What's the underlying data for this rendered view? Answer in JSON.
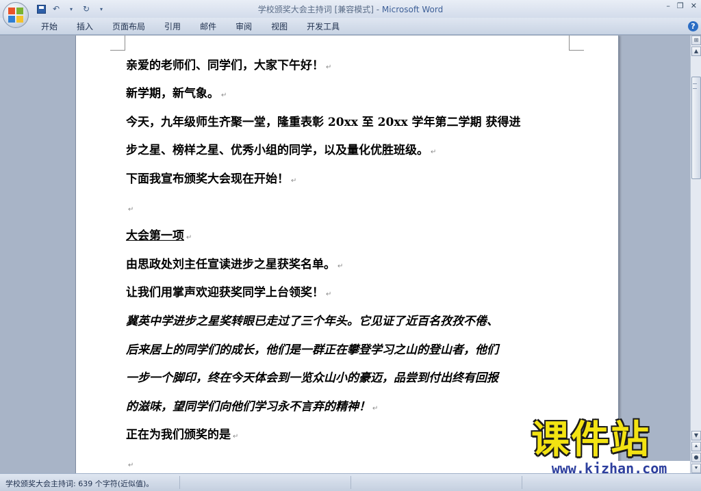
{
  "window": {
    "doc_title": "学校颁奖大会主持词 [兼容模式] - ",
    "app_name": "Microsoft Word"
  },
  "ribbon": {
    "tabs": [
      "开始",
      "插入",
      "页面布局",
      "引用",
      "邮件",
      "审阅",
      "视图",
      "开发工具"
    ],
    "help": "?"
  },
  "document": {
    "paragraphs": [
      {
        "text": "亲爱的老师们、同学们，大家下午好！",
        "mark": "↵"
      },
      {
        "text": "新学期，新气象。",
        "mark": "↵"
      },
      {
        "text": "今天，九年级师生齐聚一堂，隆重表彰 20xx 至 20xx 学年第二学期 获得进",
        "mark": ""
      },
      {
        "text": "步之星、榜样之星、优秀小组的同学，以及量化优胜班级。",
        "mark": "↵"
      },
      {
        "text": "下面我宣布颁奖大会现在开始！",
        "mark": "↵"
      },
      {
        "text": "",
        "mark": "↵"
      },
      {
        "text": "大会第一项",
        "mark": "↵"
      },
      {
        "text": "由思政处刘主任宣读进步之星获奖名单。",
        "mark": "↵"
      },
      {
        "text": "让我们用掌声欢迎获奖同学上台领奖！",
        "mark": "↵"
      },
      {
        "text": "冀英中学进步之星奖转眼已走过了三个年头。它见证了近百名孜孜不倦、",
        "mark": ""
      },
      {
        "text": "后来居上的同学们的成长，他们是一群正在攀登学习之山的登山者，他们",
        "mark": ""
      },
      {
        "text": "一步一个脚印，终在今天体会到一览众山小的豪迈，品尝到付出终有回报",
        "mark": ""
      },
      {
        "text": "的滋味，望同学们向他们学习永不言弃的精神！",
        "mark": "↵"
      },
      {
        "text": "正在为我们颁奖的是",
        "mark": "↵"
      },
      {
        "text": "",
        "mark": "↵"
      }
    ]
  },
  "watermark": {
    "big": "课件站",
    "url": "www.kjzhan.com"
  },
  "statusbar": {
    "text": "学校颁奖大会主持词: 639 个字符(近似值)。"
  }
}
